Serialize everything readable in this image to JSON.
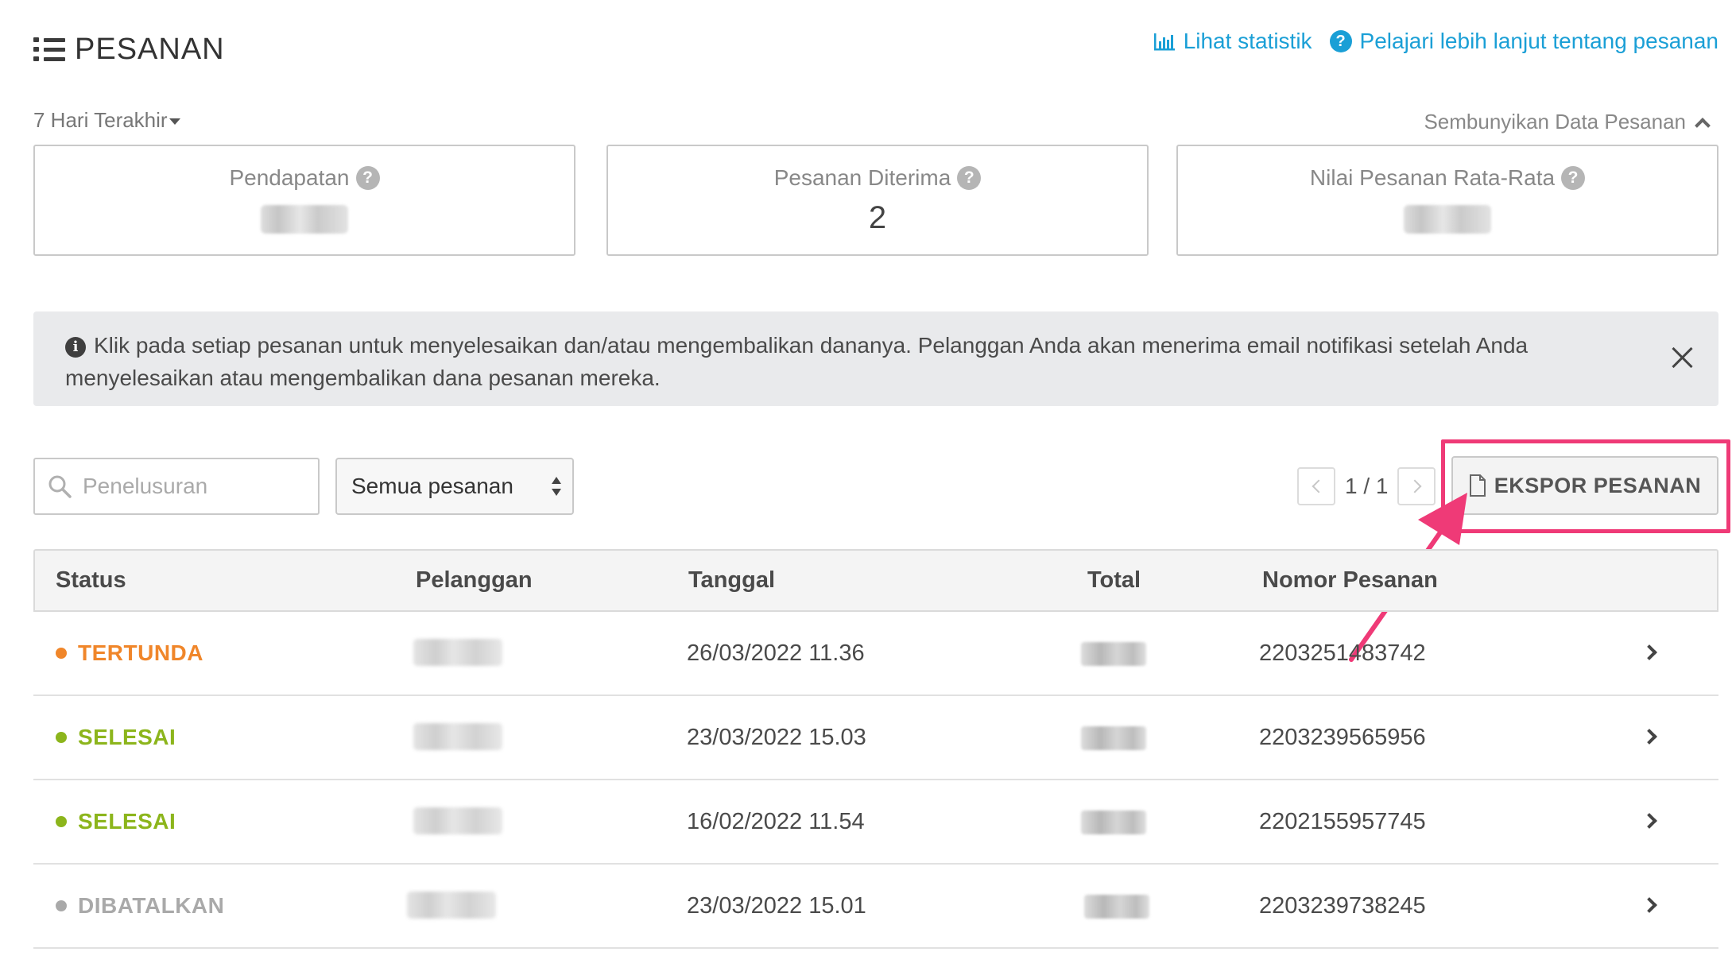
{
  "header": {
    "title": "PESANAN"
  },
  "links": {
    "stats": "Lihat statistik",
    "learn_more": "Pelajari lebih lanjut tentang pesanan"
  },
  "filters": {
    "range": "7 Hari Terakhir",
    "hide_data": "Sembunyikan Data Pesanan"
  },
  "cards": [
    {
      "label": "Pendapatan",
      "value": null
    },
    {
      "label": "Pesanan Diterima",
      "value": "2"
    },
    {
      "label": "Nilai Pesanan Rata-Rata",
      "value": null
    }
  ],
  "info": {
    "message": "Klik pada setiap pesanan untuk menyelesaikan dan/atau mengembalikan dananya. Pelanggan Anda akan menerima email notifikasi setelah Anda menyelesaikan atau mengembalikan dana pesanan mereka."
  },
  "toolbar": {
    "search_placeholder": "Penelusuran",
    "filter_selected": "Semua pesanan",
    "page": "1 / 1",
    "export_label": "EKSPOR PESANAN"
  },
  "table": {
    "headers": {
      "status": "Status",
      "customer": "Pelanggan",
      "date": "Tanggal",
      "total": "Total",
      "order_number": "Nomor Pesanan"
    },
    "rows": [
      {
        "status": "TERTUNDA",
        "status_color": "#f0862a",
        "date": "26/03/2022 11.36",
        "order_number": "2203251483742"
      },
      {
        "status": "SELESAI",
        "status_color": "#8cb51c",
        "date": "23/03/2022 15.03",
        "order_number": "2203239565956"
      },
      {
        "status": "SELESAI",
        "status_color": "#8cb51c",
        "date": "16/02/2022 11.54",
        "order_number": "2202155957745"
      },
      {
        "status": "DIBATALKAN",
        "status_color": "#a9a9a9",
        "date": "23/03/2022 15.01",
        "order_number": "2203239738245"
      }
    ]
  },
  "colors": {
    "accent": "#1a9fd6",
    "highlight": "#ef3a77"
  }
}
